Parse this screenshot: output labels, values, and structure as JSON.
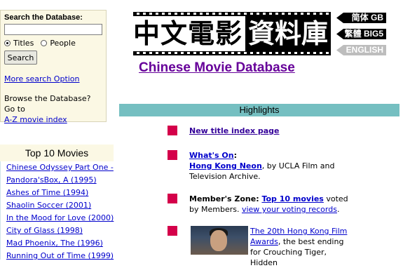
{
  "search": {
    "title": "Search the Database:",
    "input_value": "",
    "radio_titles": "Titles",
    "radio_people": "People",
    "button": "Search",
    "more_link": "More search Option",
    "browse_text": "Browse the Database? Go to",
    "az_link": "A-Z movie index"
  },
  "logo": {
    "chars_left": "中文電影",
    "chars_right": "資料庫"
  },
  "languages": {
    "gb": "简体 GB",
    "big5": "繁體 BIG5",
    "english": "ENGLISH"
  },
  "site_title": "Chinese Movie Database",
  "highlights": {
    "title": "Highlights",
    "item1_link": "New title index page",
    "item2_link": "What's On",
    "item2_colon": ":",
    "item2_link2": "Hong Kong Neon",
    "item2_text": ", by UCLA Film and Television Archive.",
    "item3_label": "Member's Zone",
    "item3_colon": ": ",
    "item3_link": "Top 10 movies",
    "item3_text": " voted by Members. ",
    "item3_link2": "view your voting records",
    "item3_end": ".",
    "item4_link": "The 20th Hong Kong Film Awards",
    "item4_text": ", the best ending for Crouching Tiger, Hidden"
  },
  "top10": {
    "title": "Top 10 Movies",
    "items": [
      "Chinese Odyssey Part One -",
      "Pandora'sBox, A (1995)",
      "Ashes of Time (1994)",
      "Shaolin Soccer (2001)",
      "In the Mood for Love (2000)",
      "City of Glass (1998)",
      "Mad Phoenix, The (1996)",
      "Running Out of Time (1999)"
    ]
  },
  "colors": {
    "accent_purple": "#660099",
    "highlights_bar": "#75bfc1",
    "bullet": "#d4004a",
    "panel_bg": "#fbf8e4"
  }
}
